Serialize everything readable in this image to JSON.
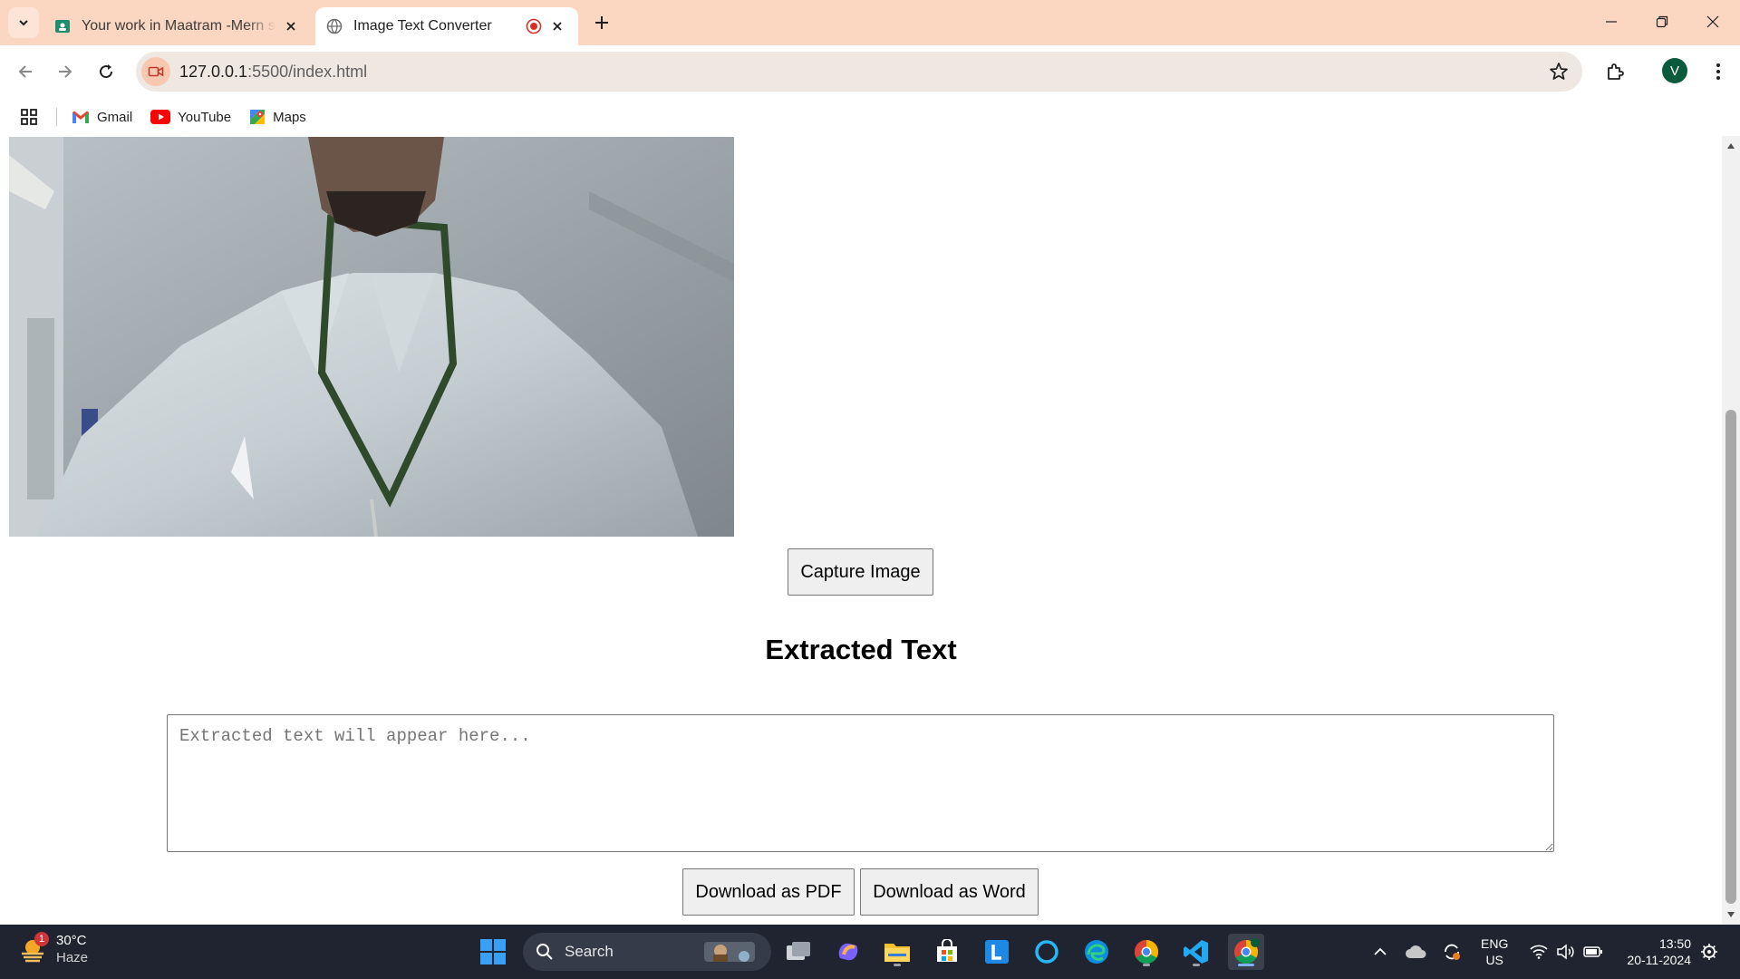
{
  "browser": {
    "tabs": [
      {
        "title": "Your work in Maatram -Mern stack",
        "active": false
      },
      {
        "title": "Image Text Converter",
        "active": true
      }
    ],
    "url_host": "127.0.0.1",
    "url_rest": ":5500/index.html",
    "profile_initial": "V",
    "bookmarks": [
      {
        "label": "Gmail",
        "icon": "gmail-icon"
      },
      {
        "label": "YouTube",
        "icon": "youtube-icon"
      },
      {
        "label": "Maps",
        "icon": "maps-icon"
      }
    ]
  },
  "page": {
    "capture_button": "Capture Image",
    "heading": "Extracted Text",
    "textarea_placeholder": "Extracted text will appear here...",
    "download_pdf": "Download as PDF",
    "download_word": "Download as Word"
  },
  "taskbar": {
    "weather_temp": "30°C",
    "weather_cond": "Haze",
    "weather_badge": "1",
    "search_label": "Search",
    "lang_top": "ENG",
    "lang_bottom": "US",
    "time": "13:50",
    "date": "20-11-2024"
  },
  "colors": {
    "tabstrip": "#fbd6c0",
    "omnibox": "#efe7e2",
    "taskbar": "#1f2430",
    "profile": "#0b5a3c"
  }
}
